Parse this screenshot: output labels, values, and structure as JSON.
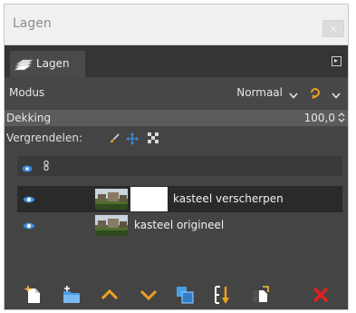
{
  "window": {
    "title": "Lagen",
    "close_glyph": "×"
  },
  "tab": {
    "label": "Lagen",
    "icon": "layers-icon"
  },
  "mode": {
    "label": "Modus",
    "value": "Normaal"
  },
  "opacity": {
    "label": "Dekking",
    "value": "100,0"
  },
  "lock": {
    "label": "Vergrendelen:",
    "icons": [
      "paintbrush-lock-icon",
      "position-lock-icon",
      "alpha-lock-icon"
    ]
  },
  "layers": [
    {
      "name": "kasteel verscherpen",
      "visible": true,
      "has_mask": true,
      "selected": true
    },
    {
      "name": "kasteel origineel",
      "visible": true,
      "has_mask": false,
      "selected": false
    }
  ],
  "toolbar": {
    "buttons": [
      "new-layer-icon",
      "new-layer-group-icon",
      "raise-layer-icon",
      "lower-layer-icon",
      "duplicate-layer-icon",
      "merge-layer-icon",
      "add-mask-icon",
      "delete-layer-icon"
    ]
  },
  "colors": {
    "accent_blue": "#2f8fd8",
    "accent_orange": "#f0a020",
    "delete_red": "#e02020",
    "panel_bg": "#444444"
  }
}
